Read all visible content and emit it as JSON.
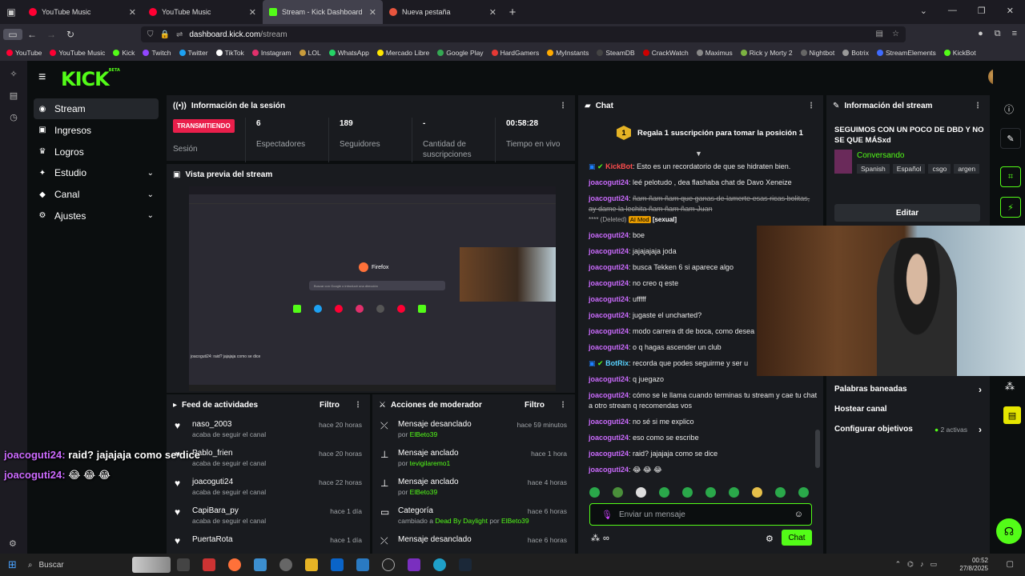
{
  "browser": {
    "tabs": [
      {
        "title": "YouTube Music",
        "color": "#ff0033"
      },
      {
        "title": "YouTube Music",
        "color": "#ff0033"
      },
      {
        "title": "Stream - Kick Dashboard",
        "color": "#53fc18",
        "active": true
      },
      {
        "title": "Nueva pestaña",
        "color": "#e8553e"
      }
    ],
    "url_domain": "dashboard.kick.com",
    "url_path": "/stream",
    "bookmarks": [
      "YouTube",
      "YouTube Music",
      "Kick",
      "Twitch",
      "Twitter",
      "TikTok",
      "Instagram",
      "LOL",
      "WhatsApp",
      "Mercado Libre",
      "Google Play",
      "HardGamers",
      "MyInstants",
      "SteamDB",
      "CrackWatch",
      "Maximus",
      "Rick y Morty 2",
      "Nightbot",
      "Botrix",
      "StreamElements",
      "KickBot"
    ]
  },
  "kick": {
    "logo": "KICK",
    "logo_beta": "BETA",
    "nav": [
      {
        "label": "Stream",
        "icon": "broadcast-icon",
        "glyph": "◉"
      },
      {
        "label": "Ingresos",
        "icon": "money-icon",
        "glyph": "▣"
      },
      {
        "label": "Logros",
        "icon": "trophy-icon",
        "glyph": "♛"
      },
      {
        "label": "Estudio",
        "icon": "studio-icon",
        "glyph": "✦",
        "chev": true
      },
      {
        "label": "Canal",
        "icon": "channel-icon",
        "glyph": "◆",
        "chev": true
      },
      {
        "label": "Ajustes",
        "icon": "gear-icon",
        "glyph": "⚙",
        "chev": true
      }
    ],
    "session": {
      "title": "Información de la sesión",
      "live_badge": "TRANSMITIENDO",
      "live_label": "Sesión",
      "viewers": "6",
      "viewers_label": "Espectadores",
      "followers": "189",
      "followers_label": "Seguidores",
      "subs": "-",
      "subs_label": "Cantidad de suscripciones",
      "uptime": "00:58:28",
      "uptime_label": "Tiempo en vivo"
    },
    "preview": {
      "title": "Vista previa del stream",
      "firefox_label": "Firefox",
      "search_placeholder": "Buscar con Google o introducir una dirección",
      "chat_overlay": "joacoguti24: raid? jajajaja como se dice"
    },
    "activity": {
      "title": "Feed de actividades",
      "filter": "Filtro",
      "items": [
        {
          "name": "naso_2003",
          "sub": "acaba de seguir el canal",
          "time": "hace 20 horas"
        },
        {
          "name": "Pablo_frien",
          "sub": "acaba de seguir el canal",
          "time": "hace 20 horas"
        },
        {
          "name": "joacoguti24",
          "sub": "acaba de seguir el canal",
          "time": "hace 22 horas"
        },
        {
          "name": "CapiBara_py",
          "sub": "acaba de seguir el canal",
          "time": "hace 1 día"
        },
        {
          "name": "PuertaRota",
          "sub": "",
          "time": "hace 1 día"
        }
      ]
    },
    "modactions": {
      "title": "Acciones de moderador",
      "filter": "Filtro",
      "items": [
        {
          "title": "Mensaje desanclado",
          "prefix": "por",
          "by": "ElBeto39",
          "time": "hace 59 minutos",
          "icon": "unpin-icon",
          "glyph": "⤫"
        },
        {
          "title": "Mensaje anclado",
          "prefix": "por",
          "by": "tevigilaremo1",
          "time": "hace 1 hora",
          "icon": "pin-icon",
          "glyph": "⊥"
        },
        {
          "title": "Mensaje anclado",
          "prefix": "por",
          "by": "ElBeto39",
          "time": "hace 4 horas",
          "icon": "pin-icon",
          "glyph": "⊥"
        },
        {
          "title": "Categoría",
          "prefix": "cambiado a",
          "extra": "Dead By Daylight",
          "mid": "por",
          "by": "ElBeto39",
          "time": "hace 6 horas",
          "icon": "category-icon",
          "glyph": "▭"
        },
        {
          "title": "Mensaje desanclado",
          "prefix": "",
          "by": "",
          "time": "hace 6 horas",
          "icon": "unpin-icon",
          "glyph": "⤫"
        }
      ]
    },
    "chat": {
      "title": "Chat",
      "goal_rank": "1",
      "goal_text": "Regala 1 suscripción para tomar la posición 1",
      "kickbot_name": "KickBot",
      "kickbot_msg": "Esto es un recordatorio de que se hidraten bien.",
      "lines": [
        {
          "user": "joacoguti24",
          "msg": "leé pelotudo , dea flashaba chat de Davo Xeneize"
        },
        {
          "user": "joacoguti24",
          "msg": "ñam ñam ñam que ganas de lamerte esas ricas bolitas, ay dame la lechita ñam ñam ñam Juan",
          "deleted": true
        },
        {
          "user": "joacoguti24",
          "msg": "boe"
        },
        {
          "user": "joacoguti24",
          "msg": "jajajajaja joda"
        },
        {
          "user": "joacoguti24",
          "msg": "busca Tekken 6 si aparece algo"
        },
        {
          "user": "joacoguti24",
          "msg": "no creo q este"
        },
        {
          "user": "joacoguti24",
          "msg": "ufffff"
        },
        {
          "user": "joacoguti24",
          "msg": "jugaste el uncharted?"
        },
        {
          "user": "joacoguti24",
          "msg": "modo carrera dt de boca, como desea"
        },
        {
          "user": "joacoguti24",
          "msg": "o q hagas ascender un club"
        }
      ],
      "deleted_label": "**** (Deleted)",
      "ai_mod": "AI Mod",
      "ai_reason": "[sexual]",
      "botrix_name": "BotRix",
      "botrix_msg": "recorda que podes seguirme y ser u",
      "lines2": [
        {
          "user": "joacoguti24",
          "msg": "q juegazo"
        },
        {
          "user": "joacoguti24",
          "msg": "cómo se le llama cuando terminas tu stream y cae tu chat a otro stream q recomendas vos"
        },
        {
          "user": "joacoguti24",
          "msg": "no sé si me explico"
        },
        {
          "user": "joacoguti24",
          "msg": "eso como se escribe"
        },
        {
          "user": "joacoguti24",
          "msg": "raid? jajajaja como se dice"
        },
        {
          "user": "joacoguti24",
          "msg": "😂 😂 😂"
        }
      ],
      "input_placeholder": "Enviar un mensaje",
      "send_label": "Chat",
      "points": "∞"
    },
    "streaminfo": {
      "title": "Información del stream",
      "stream_title": "SEGUIMOS CON UN POCO DE DBD Y NO SE QUE MÁSxd",
      "category": "Conversando",
      "tags": [
        "Spanish",
        "Español",
        "csgo",
        "argen"
      ],
      "edit_label": "Editar",
      "rows": [
        {
          "label": "Palabras baneadas",
          "extra": ""
        },
        {
          "label": "Hostear canal",
          "extra": ""
        },
        {
          "label": "Configurar objetivos",
          "extra": "2 activas"
        }
      ]
    },
    "overlay": {
      "line1_user": "joacoguti24:",
      "line1_msg": "raid? jajajaja como se dice",
      "line2_user": "joacoguti24:",
      "line2_msg": "😂 😂 😂"
    }
  },
  "taskbar": {
    "search": "Buscar",
    "time": "00:52",
    "date": "27/8/2025"
  },
  "colors": {
    "accent": "#53fc18",
    "live": "#ea1f4b",
    "username": "#cc6bff"
  }
}
